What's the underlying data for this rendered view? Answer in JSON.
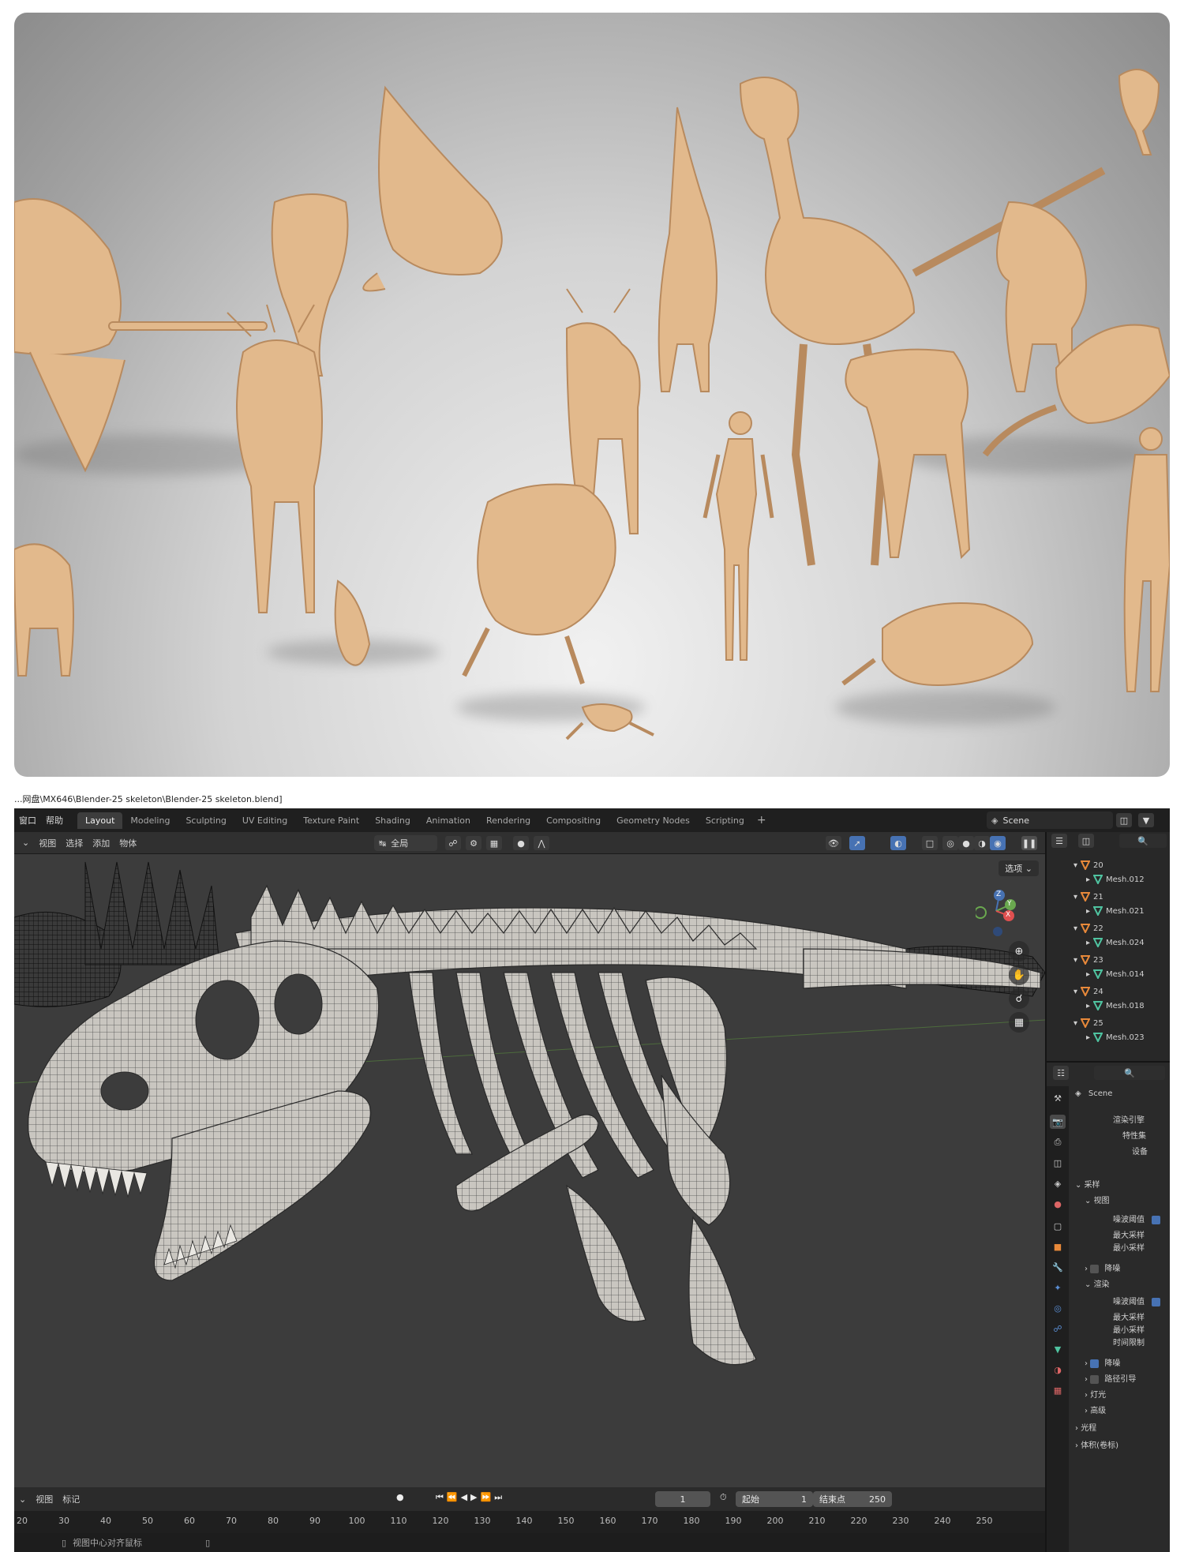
{
  "file_path": "...网盘\\MX646\\Blender-25 skeleton\\Blender-25 skeleton.blend]",
  "menu": {
    "window": "窗口",
    "help": "帮助"
  },
  "workspaces": [
    "Layout",
    "Modeling",
    "Sculpting",
    "UV Editing",
    "Texture Paint",
    "Shading",
    "Animation",
    "Rendering",
    "Compositing",
    "Geometry Nodes",
    "Scripting"
  ],
  "workspace_add": "+",
  "scene_name": "Scene",
  "viewport_header": {
    "view": "视图",
    "select": "选择",
    "add": "添加",
    "object": "物体",
    "transform_orientation": "全局",
    "options": "选项"
  },
  "axes": {
    "x": "X",
    "y": "Y",
    "z": "Z"
  },
  "outliner": [
    {
      "collection": "20",
      "mesh": "Mesh.012"
    },
    {
      "collection": "21",
      "mesh": "Mesh.021"
    },
    {
      "collection": "22",
      "mesh": "Mesh.024"
    },
    {
      "collection": "23",
      "mesh": "Mesh.014"
    },
    {
      "collection": "24",
      "mesh": "Mesh.018"
    },
    {
      "collection": "25",
      "mesh": "Mesh.023"
    }
  ],
  "properties": {
    "scene": "Scene",
    "render_engine": "渲染引擎",
    "feature_set": "特性集",
    "device": "设备",
    "sampling": "采样",
    "viewport": "视图",
    "noise_threshold": "噪波阈值",
    "max_samples": "最大采样",
    "min_samples": "最小采样",
    "denoise": "降噪",
    "render": "渲染",
    "time_limit": "时间限制",
    "path_guiding": "路径引导",
    "lights": "灯光",
    "advanced": "高级",
    "light_paths": "光程",
    "volumes": "体积(卷标)"
  },
  "timeline": {
    "view": "视图",
    "marker": "标记",
    "current_frame": "1",
    "start_label": "起始",
    "start_value": "1",
    "end_label": "结束点",
    "end_value": "250",
    "ticks": [
      "20",
      "30",
      "40",
      "50",
      "60",
      "70",
      "80",
      "90",
      "100",
      "110",
      "120",
      "130",
      "140",
      "150",
      "160",
      "170",
      "180",
      "190",
      "200",
      "210",
      "220",
      "230",
      "240",
      "250"
    ]
  },
  "status": {
    "hint": "视图中心对齐鼠标"
  },
  "colors": {
    "bone": "#e2b98c",
    "bone_shadow": "#b88a5e",
    "accent_blue": "#4772b3",
    "orange_icon": "#e8893a",
    "green_icon": "#4fc3a0"
  }
}
